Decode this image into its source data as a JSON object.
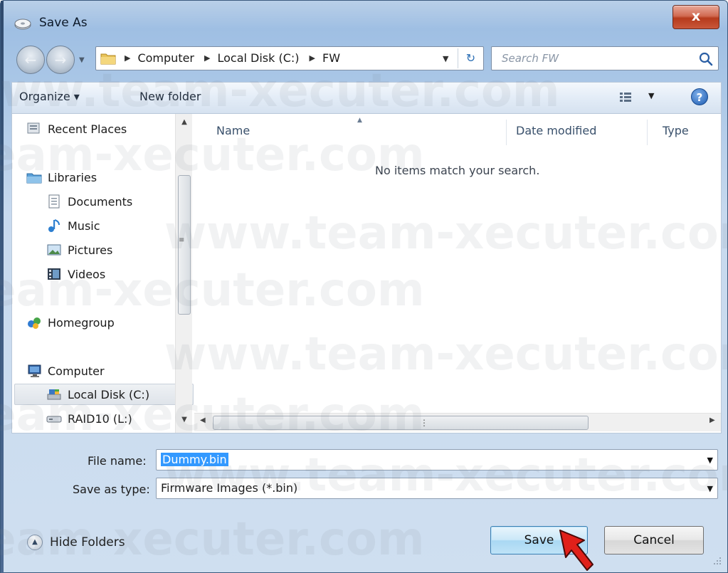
{
  "window": {
    "title": "Save As",
    "close_label": "x"
  },
  "address": {
    "crumbs": [
      "Computer",
      "Local Disk (C:)",
      "FW"
    ]
  },
  "search": {
    "placeholder": "Search FW"
  },
  "toolbar": {
    "organize_label": "Organize ▾",
    "new_folder_label": "New folder",
    "help_label": "?"
  },
  "nav_pane": {
    "items": [
      {
        "label": "Recent Places",
        "icon": "recent-places-icon"
      },
      {
        "label": "Libraries",
        "icon": "libraries-icon"
      },
      {
        "label": "Documents",
        "icon": "documents-icon"
      },
      {
        "label": "Music",
        "icon": "music-icon"
      },
      {
        "label": "Pictures",
        "icon": "pictures-icon"
      },
      {
        "label": "Videos",
        "icon": "videos-icon"
      },
      {
        "label": "Homegroup",
        "icon": "homegroup-icon"
      },
      {
        "label": "Computer",
        "icon": "computer-icon"
      },
      {
        "label": "Local Disk (C:)",
        "icon": "local-disk-icon",
        "selected": true
      },
      {
        "label": "RAID10 (L:)",
        "icon": "drive-icon"
      }
    ]
  },
  "file_list": {
    "columns": [
      "Name",
      "Date modified",
      "Type"
    ],
    "empty_message": "No items match your search."
  },
  "form": {
    "file_name_label": "File name:",
    "file_name_value": "Dummy.bin",
    "save_type_label": "Save as type:",
    "save_type_value": "Firmware Images (*.bin)"
  },
  "footer": {
    "hide_folders_label": "Hide Folders",
    "save_label": "Save",
    "cancel_label": "Cancel"
  },
  "watermark_text": [
    "www.team-xecuter.com"
  ],
  "colors": {
    "accent_selection": "#3399ff",
    "close_button": "#c9573a",
    "primary_button": "#a9d8f3"
  }
}
